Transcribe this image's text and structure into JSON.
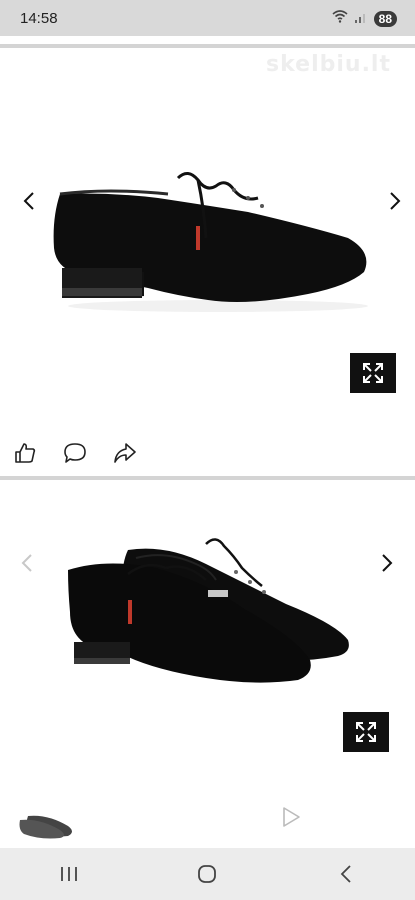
{
  "status_bar": {
    "time": "14:58",
    "battery": "88",
    "icons": [
      "wifi-icon",
      "signal-icon",
      "battery-icon"
    ]
  },
  "gallery_1": {
    "watermark": "skelbiu.lt",
    "image_subject": "black suede lace-up dance shoe, side view",
    "actions": [
      "like-icon",
      "comment-icon",
      "share-icon"
    ]
  },
  "gallery_2": {
    "image_subject": "pair of black suede lace-up dance shoes",
    "thumbnail_subject": "pair of dark shoes thumbnail",
    "video_icon": "play-icon"
  },
  "nav_bar": {
    "buttons": [
      "recent-apps-icon",
      "home-icon",
      "back-icon"
    ]
  },
  "colors": {
    "status_bar_bg": "#d9d9d9",
    "expand_button_bg": "#111111",
    "nav_bar_bg": "#ececec"
  }
}
